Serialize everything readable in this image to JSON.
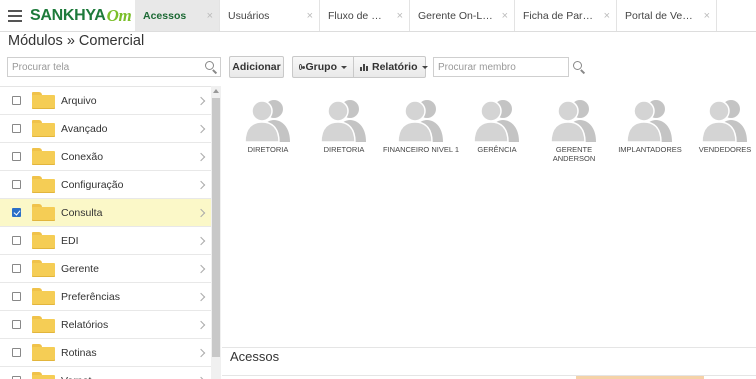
{
  "header": {
    "logo_text": "SANKHYA",
    "logo_suffix": "Om",
    "tabs": [
      {
        "label": "Acessos",
        "active": true
      },
      {
        "label": "Usuários",
        "active": false
      },
      {
        "label": "Fluxo de Caixa",
        "active": false
      },
      {
        "label": "Gerente On-Line ...",
        "active": false
      },
      {
        "label": "Ficha de Parceiros",
        "active": false
      },
      {
        "label": "Portal de Vendas",
        "active": false
      }
    ]
  },
  "breadcrumb": "Módulos » Comercial",
  "left_search": {
    "placeholder": "Procurar tela"
  },
  "toolbar": {
    "add_label": "Adicionar",
    "group_label": "Grupo",
    "report_label": "Relatório",
    "member_search_placeholder": "Procurar membro"
  },
  "modules": [
    {
      "label": "Arquivo",
      "checked": false
    },
    {
      "label": "Avançado",
      "checked": false
    },
    {
      "label": "Conexão",
      "checked": false
    },
    {
      "label": "Configuração",
      "checked": false
    },
    {
      "label": "Consulta",
      "checked": true
    },
    {
      "label": "EDI",
      "checked": false
    },
    {
      "label": "Gerente",
      "checked": false
    },
    {
      "label": "Preferências",
      "checked": false
    },
    {
      "label": "Relatórios",
      "checked": false
    },
    {
      "label": "Rotinas",
      "checked": false
    },
    {
      "label": "Vernet",
      "checked": false
    }
  ],
  "members": [
    {
      "label": "DIRETORIA"
    },
    {
      "label": "DIRETORIA"
    },
    {
      "label": "FINANCEIRO NIVEL 1"
    },
    {
      "label": "GERÊNCIA"
    },
    {
      "label": "GERENTE ANDERSON"
    },
    {
      "label": "IMPLANTADORES"
    },
    {
      "label": "VENDEDORES"
    }
  ],
  "section_title": "Acessos",
  "colors": {
    "brand": "#1d7a3a",
    "brand_accent": "#7bbf2a",
    "selected_row": "#fbf8c8",
    "folder": "#f5cd55"
  }
}
